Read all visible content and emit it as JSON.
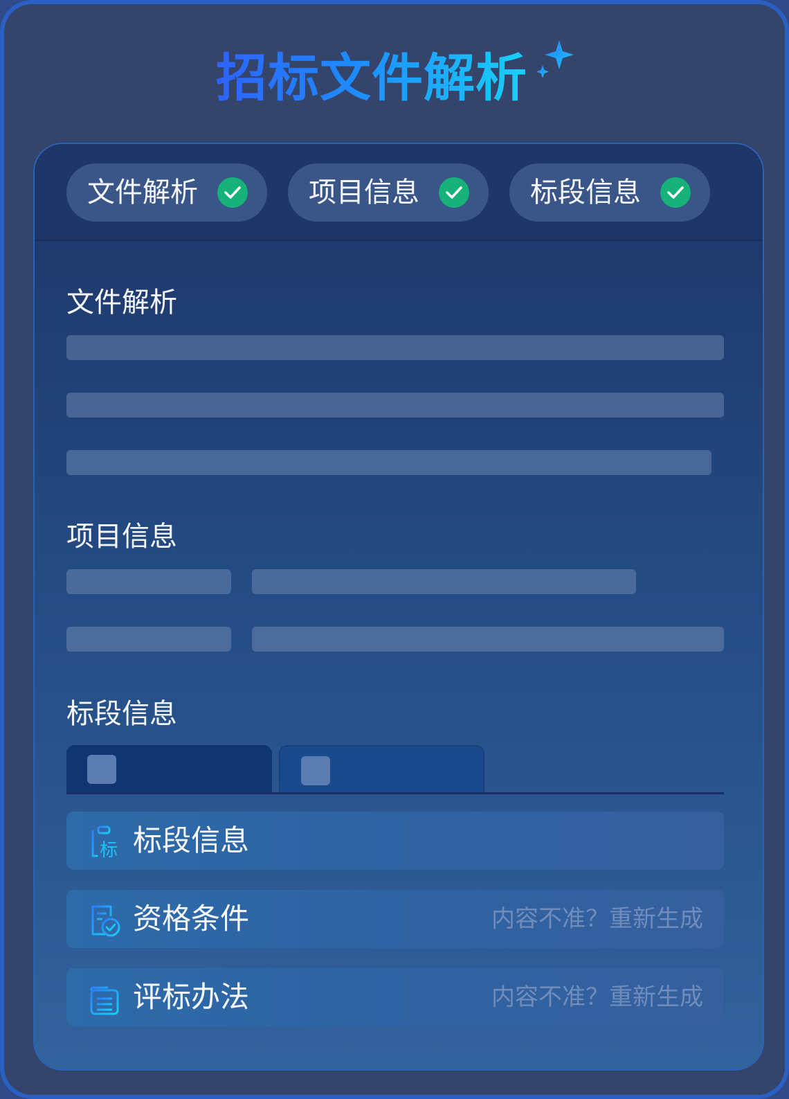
{
  "header": {
    "title": "招标文件解析"
  },
  "steps": [
    {
      "label": "文件解析",
      "status": "done"
    },
    {
      "label": "项目信息",
      "status": "done"
    },
    {
      "label": "标段信息",
      "status": "done"
    }
  ],
  "sections": {
    "file_parse": {
      "title": "文件解析"
    },
    "project_info": {
      "title": "项目信息"
    },
    "bid_section": {
      "title": "标段信息",
      "rows": [
        {
          "label": "标段信息",
          "icon": "clipboard-bid-icon",
          "action": ""
        },
        {
          "label": "资格条件",
          "icon": "document-check-icon",
          "action": "内容不准？重新生成"
        },
        {
          "label": "评标办法",
          "icon": "document-list-icon",
          "action": "内容不准？重新生成"
        }
      ]
    }
  },
  "colors": {
    "accent_start": "#2d63ff",
    "accent_end": "#19d0f8",
    "success": "#17b27a",
    "frame_border": "#2a5fc4"
  }
}
